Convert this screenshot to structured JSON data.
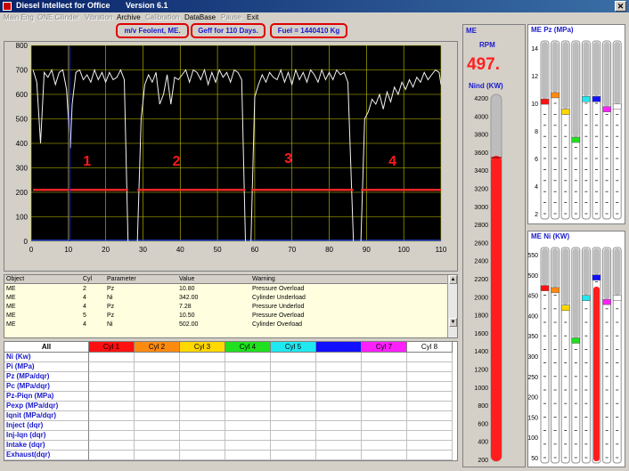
{
  "window": {
    "title": "Diesel Intellect for Office       Version 6.1",
    "close_glyph": "✕"
  },
  "menu": [
    {
      "label": "Main Eng",
      "enabled": false
    },
    {
      "label": "ONE Cilinder",
      "enabled": false
    },
    {
      "label": "Vibration",
      "enabled": false
    },
    {
      "label": "Archive",
      "enabled": true
    },
    {
      "label": "Calibration",
      "enabled": false
    },
    {
      "label": "DataBase",
      "enabled": true
    },
    {
      "label": "Pause",
      "enabled": false
    },
    {
      "label": "Exit",
      "enabled": true
    }
  ],
  "info": {
    "vessel": "m/v Feolent,  ME.",
    "geff": "Geff  for 110 Days.",
    "fuel": "Fuel = 1440410 Kg"
  },
  "colors": {
    "trace": "#f2f2f2",
    "threshold": "#ff2a2a",
    "grid": "#c8c800",
    "plot_bg": "#000000",
    "cursor": "#2020ff",
    "label": "#1a1acc",
    "rpm": "#ff2020"
  },
  "chart_data": {
    "type": "line",
    "xlim": [
      0,
      110
    ],
    "ylim": [
      0,
      800
    ],
    "x_ticks": [
      "0",
      "10",
      "20",
      "30",
      "40",
      "50",
      "60",
      "70",
      "80",
      "90",
      "100",
      "110"
    ],
    "y_ticks": [
      "0",
      "100",
      "200",
      "300",
      "400",
      "500",
      "600",
      "700",
      "800"
    ],
    "grid": true,
    "threshold_value": 210,
    "cursor_x": 10.3,
    "segments": [
      {
        "label": "1",
        "label_x": 15,
        "label_y": 310,
        "x_start": 0.5,
        "x_end": 26,
        "values": [
          [
            0.5,
            700
          ],
          [
            1.5,
            650
          ],
          [
            2.5,
            400
          ],
          [
            3.5,
            690
          ],
          [
            4.5,
            670
          ],
          [
            5.5,
            700
          ],
          [
            6.5,
            640
          ],
          [
            7.5,
            690
          ],
          [
            8.5,
            700
          ],
          [
            9.5,
            620
          ],
          [
            10.5,
            380
          ],
          [
            11,
            560
          ],
          [
            12,
            690
          ],
          [
            13,
            700
          ],
          [
            14,
            660
          ],
          [
            15,
            680
          ],
          [
            16,
            650
          ],
          [
            17,
            700
          ],
          [
            18,
            660
          ],
          [
            19,
            690
          ],
          [
            20,
            650
          ],
          [
            21,
            690
          ],
          [
            22,
            660
          ],
          [
            23,
            670
          ],
          [
            24,
            700
          ],
          [
            25,
            660
          ],
          [
            26,
            0
          ]
        ]
      },
      {
        "label": "2",
        "label_x": 39,
        "label_y": 310,
        "x_start": 28.5,
        "x_end": 57.5,
        "values": [
          [
            28.5,
            0
          ],
          [
            29.5,
            500
          ],
          [
            30.5,
            640
          ],
          [
            31.5,
            680
          ],
          [
            32.5,
            650
          ],
          [
            33.5,
            690
          ],
          [
            34.5,
            560
          ],
          [
            35.5,
            600
          ],
          [
            36.5,
            680
          ],
          [
            37.5,
            560
          ],
          [
            38.5,
            670
          ],
          [
            39.5,
            660
          ],
          [
            40.5,
            680
          ],
          [
            41.5,
            700
          ],
          [
            42.5,
            650
          ],
          [
            43.5,
            700
          ],
          [
            44.5,
            690
          ],
          [
            45.5,
            660
          ],
          [
            46.5,
            700
          ],
          [
            47.5,
            640
          ],
          [
            48.5,
            690
          ],
          [
            49.5,
            650
          ],
          [
            50.5,
            700
          ],
          [
            51.5,
            670
          ],
          [
            52.5,
            690
          ],
          [
            53.5,
            650
          ],
          [
            54.5,
            700
          ],
          [
            55.5,
            690
          ],
          [
            56.5,
            660
          ],
          [
            57.5,
            0
          ]
        ]
      },
      {
        "label": "3",
        "label_x": 69,
        "label_y": 320,
        "x_start": 59,
        "x_end": 86.5,
        "values": [
          [
            59,
            0
          ],
          [
            60,
            590
          ],
          [
            61,
            640
          ],
          [
            62,
            680
          ],
          [
            63,
            650
          ],
          [
            64,
            690
          ],
          [
            65,
            670
          ],
          [
            66,
            660
          ],
          [
            67,
            700
          ],
          [
            68,
            650
          ],
          [
            69,
            690
          ],
          [
            70,
            640
          ],
          [
            71,
            700
          ],
          [
            72,
            660
          ],
          [
            73,
            690
          ],
          [
            74,
            650
          ],
          [
            75,
            700
          ],
          [
            76,
            680
          ],
          [
            77,
            650
          ],
          [
            78,
            700
          ],
          [
            79,
            660
          ],
          [
            80,
            690
          ],
          [
            81,
            660
          ],
          [
            82,
            700
          ],
          [
            83,
            680
          ],
          [
            84,
            690
          ],
          [
            85,
            650
          ],
          [
            86.5,
            0
          ]
        ]
      },
      {
        "label": "4",
        "label_x": 97,
        "label_y": 310,
        "x_start": 88.5,
        "x_end": 110,
        "values": [
          [
            88.5,
            0
          ],
          [
            89.5,
            500
          ],
          [
            90.5,
            530
          ],
          [
            91.5,
            580
          ],
          [
            92.5,
            560
          ],
          [
            93.5,
            600
          ],
          [
            94.5,
            540
          ],
          [
            95.5,
            610
          ],
          [
            96.5,
            570
          ],
          [
            97.5,
            630
          ],
          [
            98.5,
            600
          ],
          [
            99.5,
            650
          ],
          [
            100.5,
            620
          ],
          [
            101.5,
            660
          ],
          [
            102.5,
            630
          ],
          [
            103.5,
            670
          ],
          [
            104.5,
            650
          ],
          [
            105.5,
            690
          ],
          [
            106.5,
            660
          ],
          [
            107.5,
            680
          ],
          [
            108.5,
            700
          ],
          [
            109.5,
            690
          ],
          [
            110,
            640
          ]
        ]
      }
    ]
  },
  "warnings": {
    "columns": [
      "Object",
      "Cyl",
      "Parameter",
      "Value",
      "Warning"
    ],
    "rows": [
      [
        "ME",
        "2",
        "Pz",
        "10.80",
        "Pressure Overload"
      ],
      [
        "ME",
        "4",
        "Ni",
        "342.00",
        "Cylinder Underload"
      ],
      [
        "ME",
        "4",
        "Pz",
        "7.28",
        "Pressure Underlod"
      ],
      [
        "ME",
        "5",
        "Pz",
        "10.50",
        "Pressure Overload"
      ],
      [
        "ME",
        "4",
        "Ni",
        "502.00",
        "Cylinder Overload"
      ]
    ]
  },
  "params": {
    "all_label": "All",
    "cylinders": [
      {
        "label": "Cyl 1",
        "color": "#ff1010",
        "text": "#000"
      },
      {
        "label": "Cyl 2",
        "color": "#ff8a10",
        "text": "#000"
      },
      {
        "label": "Cyl 3",
        "color": "#ffd800",
        "text": "#000"
      },
      {
        "label": "Cyl 4",
        "color": "#20e020",
        "text": "#000"
      },
      {
        "label": "Cyl 5",
        "color": "#20e8f0",
        "text": "#000"
      },
      {
        "label": "Cyl 6",
        "color": "#1010ff",
        "text": "#1010ff"
      },
      {
        "label": "Cyl 7",
        "color": "#ff20ff",
        "text": "#000"
      },
      {
        "label": "Cyl 8",
        "color": "#ffffff",
        "text": "#000"
      }
    ],
    "rows": [
      "Ni    (Kw)",
      "Pi    (MPa)",
      "Pz     (MPa/dqr)",
      "Pc      (MPa/dqr)",
      "Pz-Piqn     (MPa)",
      "Pexp   (MPa/dqr)",
      "Iqnit  (MPa/dqr)",
      "Inject (dqr)",
      "Inj-Iqn  (dqr)",
      "Intake (dqr)",
      "Exhaust(dqr)"
    ]
  },
  "me_gauge": {
    "title": "ME",
    "rpm_label": "RPM",
    "rpm_value": "497.",
    "nind_label": "Nind (KW)",
    "scale": [
      "4200",
      "4000",
      "3800",
      "3600",
      "3400",
      "3200",
      "3000",
      "2800",
      "2600",
      "2400",
      "2200",
      "2000",
      "1800",
      "1600",
      "1400",
      "1200",
      "1000",
      "800",
      "600",
      "400",
      "200"
    ],
    "max": 4200,
    "min": 200,
    "value": 3560
  },
  "pz_panel": {
    "title": "ME Pz  (MPa)",
    "scale": [
      "14",
      "12",
      "10",
      "8",
      "6",
      "4",
      "2"
    ],
    "max": 15,
    "values": [
      10.3,
      10.8,
      9.5,
      7.3,
      10.5,
      10.5,
      9.7,
      9.9
    ]
  },
  "ni_panel": {
    "title": "ME Ni  (KW)",
    "scale": [
      "550",
      "500",
      "450",
      "400",
      "350",
      "300",
      "250",
      "200",
      "150",
      "100",
      "50"
    ],
    "max": 580,
    "values": [
      475,
      470,
      425,
      342,
      450,
      502,
      440,
      450
    ]
  }
}
